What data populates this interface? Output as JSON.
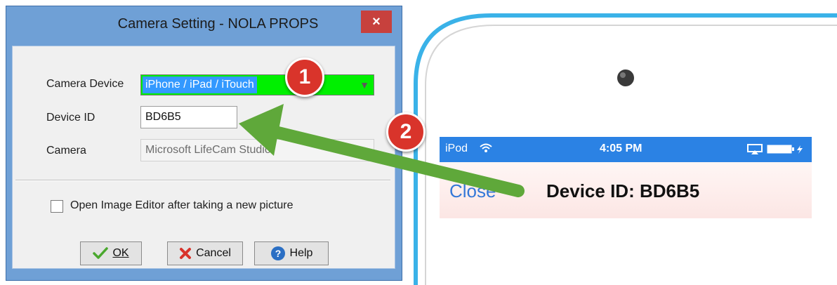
{
  "dialog": {
    "title": "Camera Setting - NOLA PROPS",
    "close_glyph": "×",
    "camera_device_label": "Camera Device",
    "camera_device_value": "iPhone / iPad / iTouch",
    "camera_device_highlight_color": "#00f000",
    "device_id_label": "Device ID",
    "device_id_value": "BD6B5",
    "camera_label": "Camera",
    "camera_value": "Microsoft LifeCam Studio",
    "checkbox_label": "Open Image Editor after taking a new picture",
    "checkbox_checked": false,
    "buttons": {
      "ok": "OK",
      "cancel": "Cancel",
      "help": "Help"
    }
  },
  "callouts": {
    "step1": "1",
    "step2": "2",
    "badge_color": "#d9342b",
    "arrow_color": "#5fa83a"
  },
  "phone": {
    "carrier": "iPod",
    "time": "4:05 PM",
    "close_label": "Close",
    "device_id_title": "Device ID: BD6B5",
    "frame_color": "#3ab2e8",
    "statusbar_color": "#2b82e4"
  }
}
